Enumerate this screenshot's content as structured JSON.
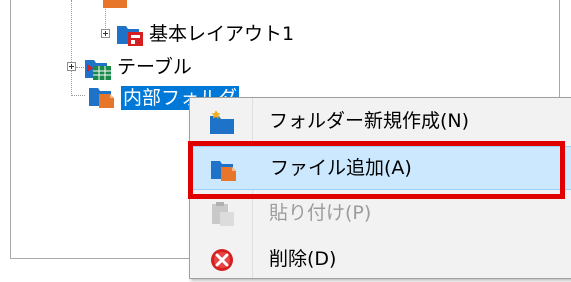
{
  "tree": {
    "nodes": [
      {
        "label": "基本レイアウト1",
        "icon": "layout-folder-icon"
      },
      {
        "label": "テーブル",
        "icon": "table-folder-icon"
      },
      {
        "label": "内部フォルダ",
        "icon": "internal-folder-icon",
        "selected": true
      }
    ]
  },
  "context_menu": {
    "items": [
      {
        "label": "フォルダー新規作成(N)",
        "icon": "new-folder-icon",
        "enabled": true
      },
      {
        "label": "ファイル追加(A)",
        "icon": "add-file-icon",
        "enabled": true,
        "highlighted": true
      },
      {
        "label": "貼り付け(P)",
        "icon": "paste-icon",
        "enabled": false
      },
      {
        "label": "削除(D)",
        "icon": "delete-icon",
        "enabled": true
      }
    ]
  },
  "colors": {
    "selection": "#0078d7",
    "menu_hover": "#cce8ff",
    "annotation_box": "#e00000",
    "delete_red": "#d42020"
  }
}
